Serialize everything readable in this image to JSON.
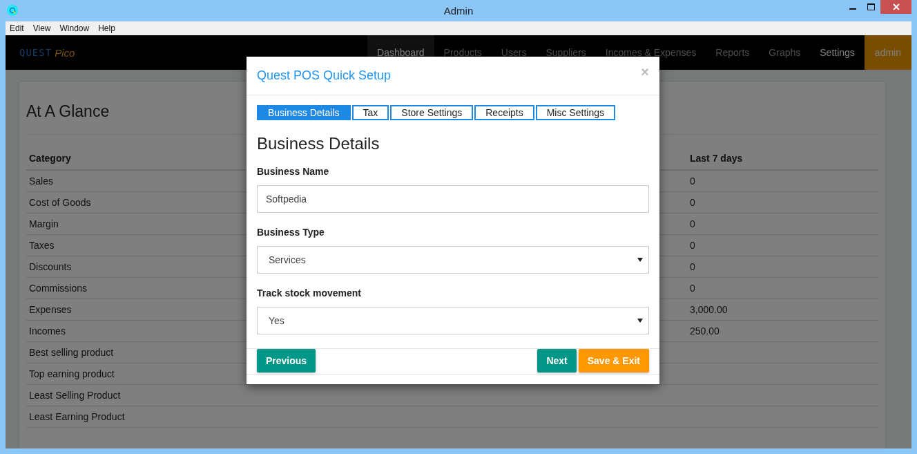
{
  "window": {
    "title": "Admin"
  },
  "menu": [
    "Edit",
    "View",
    "Window",
    "Help"
  ],
  "logo": {
    "brand": "QUEST",
    "product": "Pico"
  },
  "nav": {
    "items": [
      {
        "label": "Dashboard",
        "selected": true,
        "highlighted": false
      },
      {
        "label": "Products",
        "selected": false,
        "highlighted": false
      },
      {
        "label": "Users",
        "selected": false,
        "highlighted": false
      },
      {
        "label": "Suppliers",
        "selected": false,
        "highlighted": false
      },
      {
        "label": "Incomes & Expenses",
        "selected": false,
        "highlighted": false
      },
      {
        "label": "Reports",
        "selected": false,
        "highlighted": false
      },
      {
        "label": "Graphs",
        "selected": false,
        "highlighted": false
      },
      {
        "label": "Settings",
        "selected": false,
        "highlighted": true
      }
    ],
    "user": "admin"
  },
  "panel": {
    "title": "At A Glance",
    "columns": [
      "Category",
      "Last 7 days"
    ],
    "rows": [
      {
        "category": "Sales",
        "last_7_days": "0"
      },
      {
        "category": "Cost of Goods",
        "last_7_days": "0"
      },
      {
        "category": "Margin",
        "last_7_days": "0"
      },
      {
        "category": "Taxes",
        "last_7_days": "0"
      },
      {
        "category": "Discounts",
        "last_7_days": "0"
      },
      {
        "category": "Commissions",
        "last_7_days": "0"
      },
      {
        "category": "Expenses",
        "last_7_days": "3,000.00"
      },
      {
        "category": "Incomes",
        "last_7_days": "250.00"
      },
      {
        "category": "Best selling product"
      },
      {
        "category": "Top earning product"
      },
      {
        "category": "Least Selling Product"
      },
      {
        "category": "Least Earning Product"
      }
    ]
  },
  "dialog": {
    "title": "Quest POS Quick Setup",
    "close": "×",
    "tabs": [
      {
        "label": "Business Details",
        "selected": true
      },
      {
        "label": "Tax",
        "selected": false
      },
      {
        "label": "Store Settings",
        "selected": false
      },
      {
        "label": "Receipts",
        "selected": false
      },
      {
        "label": "Misc Settings",
        "selected": false
      }
    ],
    "heading": "Business Details",
    "fields": [
      {
        "kind": "text",
        "label": "Business Name",
        "value": "Softpedia"
      },
      {
        "kind": "select",
        "label": "Business Type",
        "value": "Services"
      },
      {
        "kind": "select",
        "label": "Track stock movement",
        "value": "Yes"
      }
    ],
    "buttons_left": [
      {
        "label": "Previous",
        "color": "#009688"
      }
    ],
    "buttons_right": [
      {
        "label": "Next",
        "color": "#009688"
      },
      {
        "label": "Save & Exit",
        "color": "#ff9800"
      }
    ]
  }
}
